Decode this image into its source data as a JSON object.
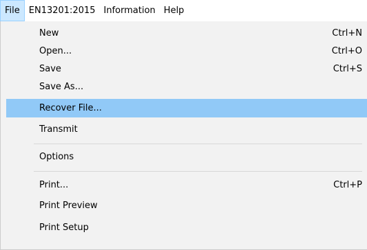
{
  "menubar": {
    "items": [
      {
        "label": "File"
      },
      {
        "label": "EN13201:2015"
      },
      {
        "label": "Information"
      },
      {
        "label": "Help"
      }
    ]
  },
  "file_menu": {
    "items": [
      {
        "label": "New",
        "shortcut": "Ctrl+N"
      },
      {
        "label": "Open...",
        "shortcut": "Ctrl+O"
      },
      {
        "label": "Save",
        "shortcut": "Ctrl+S"
      },
      {
        "label": "Save As...",
        "shortcut": ""
      },
      {
        "label": "Recover File...",
        "shortcut": ""
      },
      {
        "label": "Transmit",
        "shortcut": ""
      },
      {
        "label": "Options",
        "shortcut": ""
      },
      {
        "label": "Print...",
        "shortcut": "Ctrl+P"
      },
      {
        "label": "Print Preview",
        "shortcut": ""
      },
      {
        "label": "Print Setup",
        "shortcut": ""
      }
    ],
    "highlighted_item": "Recover File...",
    "highlight_color": "#91c9f7"
  }
}
